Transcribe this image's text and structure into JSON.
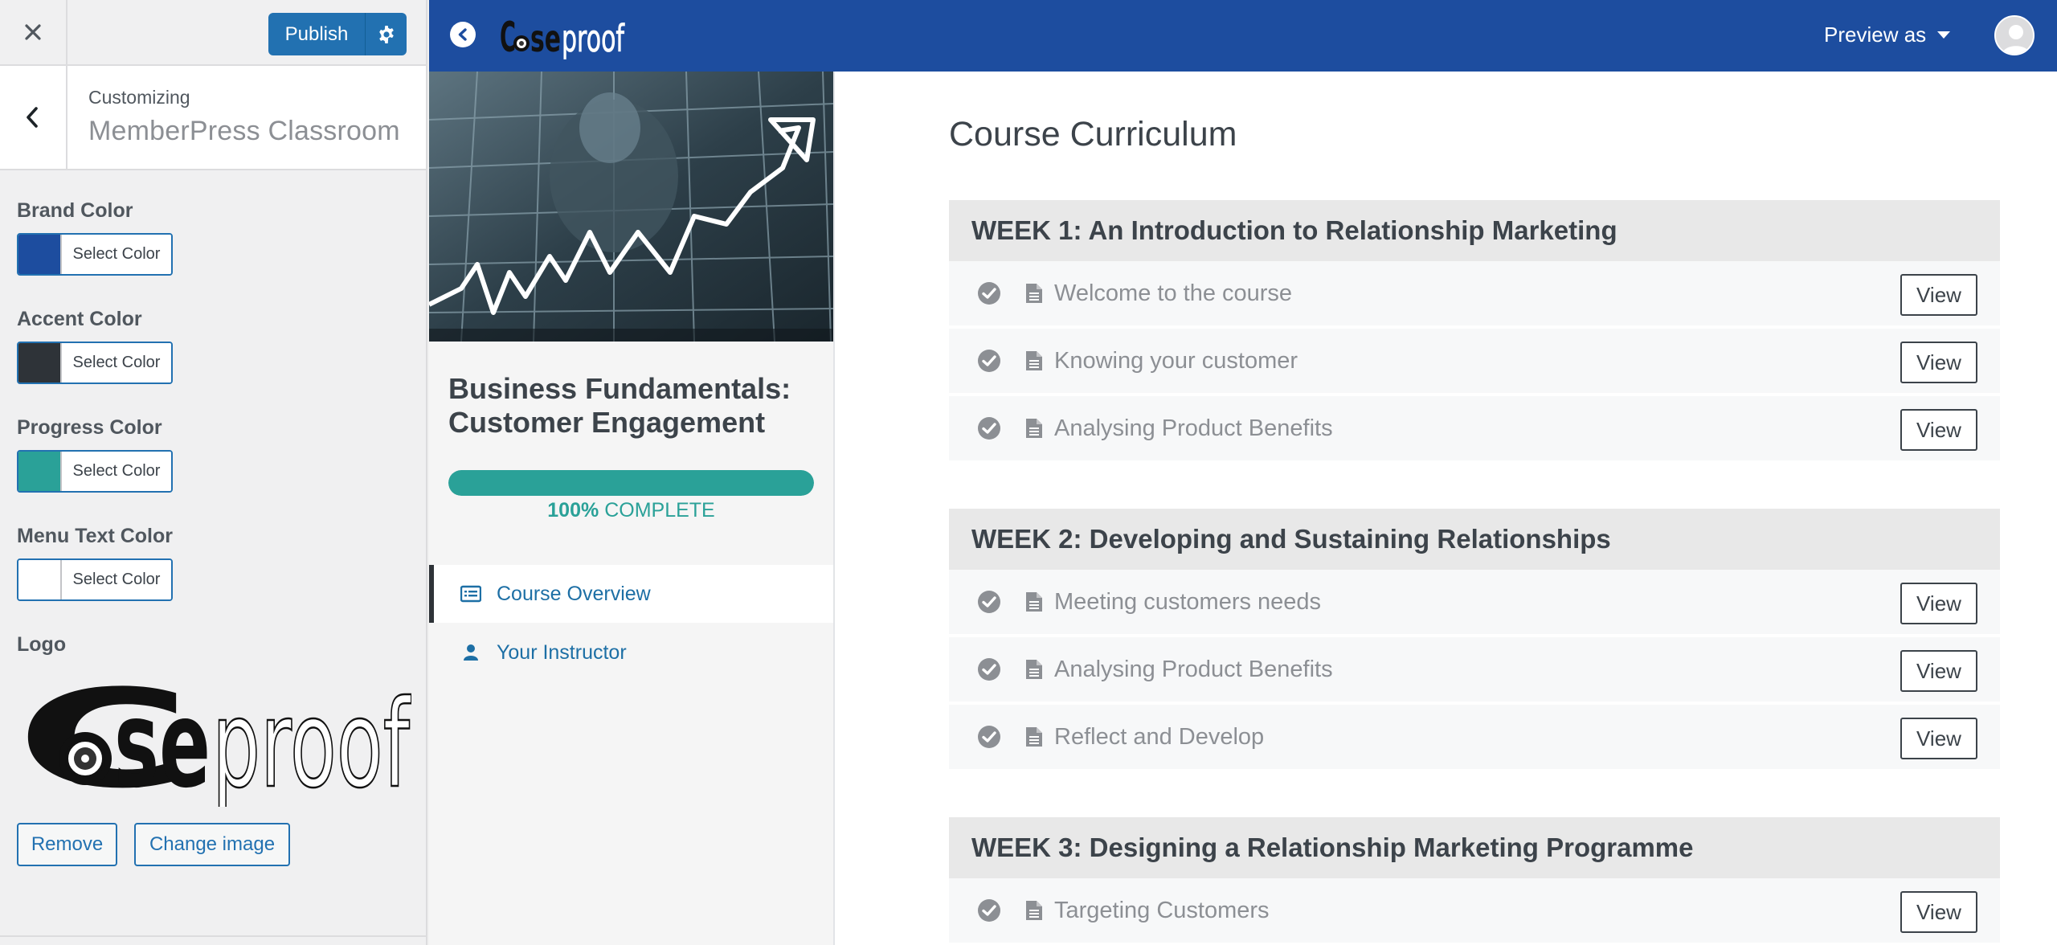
{
  "customizer": {
    "publish_label": "Publish",
    "customizing_label": "Customizing",
    "section_title": "MemberPress Classroom",
    "controls": [
      {
        "label": "Brand Color",
        "button_text": "Select Color",
        "color": "#1d4d9f"
      },
      {
        "label": "Accent Color",
        "button_text": "Select Color",
        "color": "#2e3338"
      },
      {
        "label": "Progress Color",
        "button_text": "Select Color",
        "color": "#2aa198"
      },
      {
        "label": "Menu Text Color",
        "button_text": "Select Color",
        "color": "#ffffff"
      }
    ],
    "logo_label": "Logo",
    "logo_text": "Caseproof",
    "remove_label": "Remove",
    "change_image_label": "Change image"
  },
  "preview": {
    "brand_logo_text": "Caseproof",
    "preview_as_label": "Preview as",
    "course": {
      "title": "Business Fundamentals: Customer Engagement",
      "progress_percent": 100,
      "progress_value_label": "100%",
      "progress_suffix": "COMPLETE",
      "nav": [
        {
          "label": "Course Overview",
          "icon": "list-icon",
          "active": true
        },
        {
          "label": "Your Instructor",
          "icon": "user-icon",
          "active": false
        }
      ]
    },
    "curriculum_title": "Course Curriculum",
    "view_label": "View",
    "weeks": [
      {
        "title": "WEEK 1: An Introduction to Relationship Marketing",
        "lessons": [
          "Welcome to the course",
          "Knowing your customer",
          "Analysing Product Benefits"
        ]
      },
      {
        "title": "WEEK 2: Developing and Sustaining Relationships",
        "lessons": [
          "Meeting customers needs",
          "Analysing Product Benefits",
          "Reflect and Develop"
        ]
      },
      {
        "title": "WEEK 3: Designing a Relationship Marketing Programme",
        "lessons": [
          "Targeting Customers"
        ]
      }
    ]
  }
}
